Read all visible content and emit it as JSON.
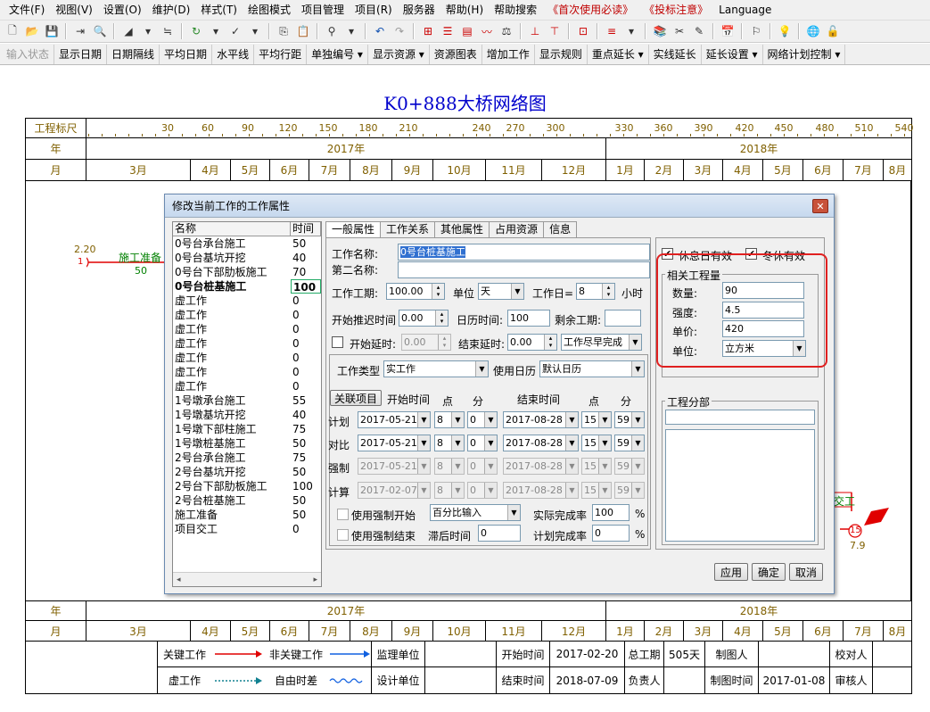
{
  "menubar": {
    "items": [
      "文件(F)",
      "视图(V)",
      "设置(O)",
      "维护(D)",
      "样式(T)",
      "绘图模式",
      "项目管理",
      "项目(R)",
      "服务器",
      "帮助(H)",
      "帮助搜索",
      "《首次使用必读》",
      "《投标注意》",
      "Language"
    ]
  },
  "textbar": {
    "items": [
      "输入状态",
      "显示日期",
      "日期隔线",
      "平均日期",
      "水平线",
      "平均行距",
      "单独编号 ▾",
      "显示资源 ▾",
      "资源图表",
      "增加工作",
      "显示规则",
      "重点延长 ▾",
      "实线延长",
      "延长设置 ▾",
      "网络计划控制 ▾"
    ]
  },
  "chart": {
    "title": "K0+888大桥网络图",
    "row_labels": {
      "scale": "工程标尺",
      "year": "年",
      "month": "月"
    },
    "scale_ticks": [
      "30",
      "60",
      "90",
      "120",
      "150",
      "180",
      "210",
      "240",
      "270",
      "300",
      "330",
      "360",
      "390",
      "420",
      "450",
      "480",
      "510",
      "540"
    ],
    "years": [
      "2017年",
      "2018年"
    ],
    "months": [
      "3月",
      "4月",
      "5月",
      "6月",
      "7月",
      "8月",
      "9月",
      "10月",
      "11月",
      "12月",
      "1月",
      "2月",
      "3月",
      "4月",
      "5月",
      "6月",
      "7月",
      "8月"
    ],
    "node_start": {
      "num": "1",
      "time": "2.20",
      "task": "施工准备",
      "days": "50"
    },
    "node_end": {
      "num": "15",
      "time": "7.9",
      "task": "交工"
    }
  },
  "legend": {
    "critical": "关键工作",
    "noncritical": "非关键工作",
    "dummy": "虚工作",
    "float": "自由时差",
    "supervisor": "监理单位",
    "designer": "设计单位",
    "start_label": "开始时间",
    "start_value": "2017-02-20",
    "end_label": "结束时间",
    "end_value": "2018-07-09",
    "duration_label": "总工期",
    "duration_value": "505天",
    "owner_label": "负责人",
    "drawer_label": "制图人",
    "drawdate_label": "制图时间",
    "drawdate_value": "2017-01-08",
    "checker_label": "校对人",
    "approver_label": "审核人"
  },
  "dialog": {
    "title": "修改当前工作的工作属性",
    "list_head": {
      "name": "名称",
      "time": "时间"
    },
    "list": [
      {
        "name": "0号台承台施工",
        "time": "50"
      },
      {
        "name": "0号台基坑开挖",
        "time": "40"
      },
      {
        "name": "0号台下部肋板施工",
        "time": "70"
      },
      {
        "name": "0号台桩基施工",
        "time": "100"
      },
      {
        "name": "虚工作",
        "time": "0"
      },
      {
        "name": "虚工作",
        "time": "0"
      },
      {
        "name": "虚工作",
        "time": "0"
      },
      {
        "name": "虚工作",
        "time": "0"
      },
      {
        "name": "虚工作",
        "time": "0"
      },
      {
        "name": "虚工作",
        "time": "0"
      },
      {
        "name": "虚工作",
        "time": "0"
      },
      {
        "name": "1号墩承台施工",
        "time": "55"
      },
      {
        "name": "1号墩基坑开挖",
        "time": "40"
      },
      {
        "name": "1号墩下部柱施工",
        "time": "75"
      },
      {
        "name": "1号墩桩基施工",
        "time": "50"
      },
      {
        "name": "2号台承台施工",
        "time": "75"
      },
      {
        "name": "2号台基坑开挖",
        "time": "50"
      },
      {
        "name": "2号台下部肋板施工",
        "time": "100"
      },
      {
        "name": "2号台桩基施工",
        "time": "50"
      },
      {
        "name": "施工准备",
        "time": "50"
      },
      {
        "name": "项目交工",
        "time": "0"
      }
    ],
    "tabs": [
      "一般属性",
      "工作关系",
      "其他属性",
      "占用资源",
      "信息"
    ],
    "f": {
      "name_label": "工作名称:",
      "name_value": "0号台桩基施工",
      "alt_label": "第二名称:",
      "alt_value": "",
      "dur_label": "工作工期:",
      "dur_value": "100.00",
      "unit_label": "单位",
      "unit_value": "天",
      "workday_label": "工作日=",
      "workday_value": "8",
      "hour": "小时",
      "push_label": "开始推迟时间",
      "push_value": "0.00",
      "cal_label": "日历时间:",
      "cal_value": "100",
      "remain_label": "剩余工期:",
      "remain_value": "",
      "startdelay_label": "开始延时:",
      "startdelay_value": "0.00",
      "enddelay_label": "结束延时:",
      "enddelay_value": "0.00",
      "asap": "工作尽早完成",
      "type_label": "工作类型",
      "type_value": "实工作",
      "calendar_label": "使用日历",
      "calendar_value": "默认日历",
      "related_btn": "关联项目",
      "start_time": "开始时间",
      "point": "点",
      "minute": "分",
      "end_time": "结束时间",
      "rows": [
        {
          "label": "计划",
          "sd": "2017-05-21",
          "sh": "8",
          "sm": "0",
          "ed": "2017-08-28",
          "eh": "15",
          "em": "59"
        },
        {
          "label": "对比",
          "sd": "2017-05-21",
          "sh": "8",
          "sm": "0",
          "ed": "2017-08-28",
          "eh": "15",
          "em": "59"
        },
        {
          "label": "强制",
          "sd": "2017-05-21",
          "sh": "8",
          "sm": "0",
          "ed": "2017-08-28",
          "eh": "15",
          "em": "59"
        },
        {
          "label": "计算",
          "sd": "2017-02-07",
          "sh": "8",
          "sm": "0",
          "ed": "2017-08-28",
          "eh": "15",
          "em": "59"
        }
      ],
      "force_start": "使用强制开始",
      "pct_input": "百分比输入",
      "actual_label": "实际完成率",
      "actual_value": "100",
      "pct": "%",
      "force_end": "使用强制结束",
      "lag_label": "滞后时间",
      "lag_value": "0",
      "plan_label": "计划完成率",
      "plan_value": "0",
      "rest_label": "休息日有效",
      "winter_label": "冬休有效",
      "qty_group": "相关工程量",
      "qty_label": "数量:",
      "qty_value": "90",
      "int_label": "强度:",
      "int_value": "4.5",
      "price_label": "单价:",
      "price_value": "420",
      "qunit_label": "单位:",
      "qunit_value": "立方米",
      "part_group": "工程分部"
    },
    "buttons": {
      "apply": "应用",
      "ok": "确定",
      "cancel": "取消"
    }
  },
  "colors": {
    "critical": "#e00000",
    "noncritical": "#1060e0",
    "axis": "#806000",
    "title": "#0000cc"
  }
}
